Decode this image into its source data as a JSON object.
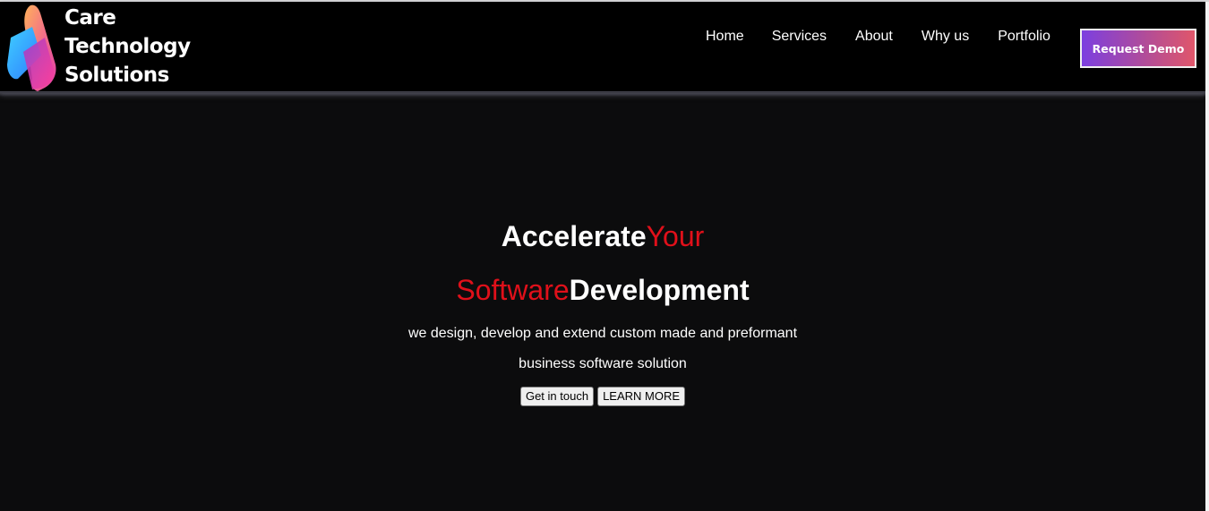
{
  "brand": {
    "name_lines": [
      "Care",
      "Technology",
      "Solutions"
    ],
    "logo_icon": "care-technology-logo-icon"
  },
  "nav": {
    "items": [
      {
        "label": "Home"
      },
      {
        "label": "Services"
      },
      {
        "label": "About"
      },
      {
        "label": "Why us"
      },
      {
        "label": "Portfolio"
      }
    ],
    "cta_label": "Request Demo"
  },
  "hero": {
    "line1_white": "Accelerate",
    "line1_red": "Your",
    "line2_red": "Software",
    "line2_white": "Development",
    "subtitle_line1": "we design, develop and extend custom made and preformant",
    "subtitle_line2": "business software solution",
    "primary_button": "Get in touch",
    "secondary_button": "LEARN MORE"
  },
  "colors": {
    "background": "#0c0c0d",
    "header": "#000000",
    "accent_red": "#e0101a",
    "cta_gradient_start": "#7c3fe0",
    "cta_gradient_end": "#e0566a"
  }
}
